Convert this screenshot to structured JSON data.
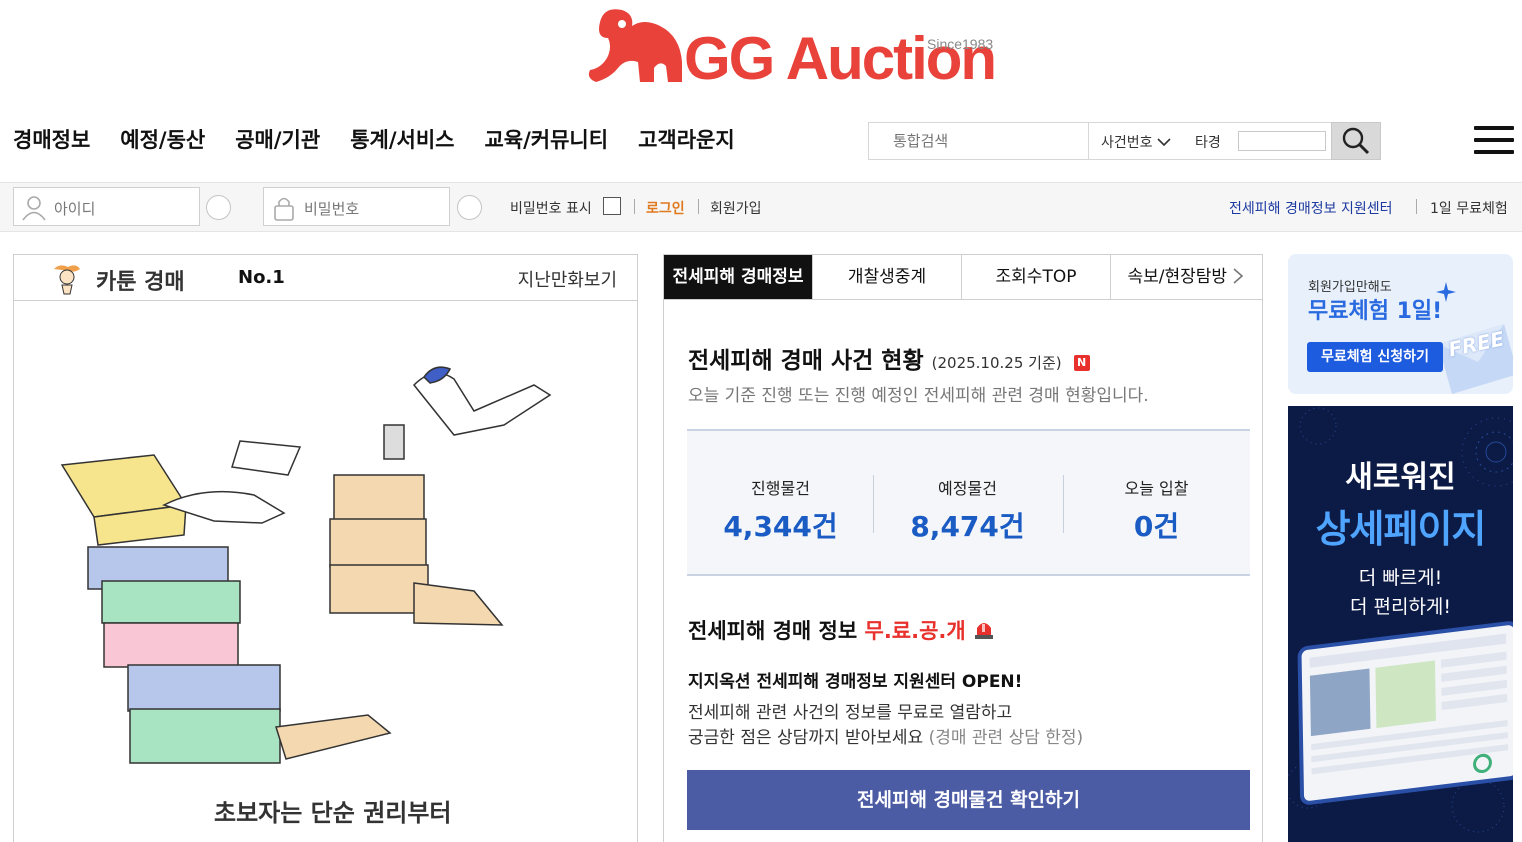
{
  "logo": {
    "brand": "GG Auction",
    "since": "Since1983"
  },
  "nav": {
    "items": [
      "경매정보",
      "예정/동산",
      "공매/기관",
      "통계/서비스",
      "교육/커뮤니티",
      "고객라운지"
    ]
  },
  "search": {
    "placeholder": "통합검색",
    "case_select": "사건번호",
    "court_label": "타경",
    "icon": "search-icon"
  },
  "login": {
    "id_placeholder": "아이디",
    "pw_placeholder": "비밀번호",
    "show_pw_label": "비밀번호 표시",
    "login_label": "로그인",
    "join_label": "회원가입",
    "center_link": "전세피해 경매정보 지원센터",
    "trial_link": "1일 무료체험"
  },
  "cartoon": {
    "title": "카툰 경매",
    "number": "No.1",
    "past_link": "지난만화보기",
    "caption": "초보자는 단순 권리부터"
  },
  "tabs": [
    "전세피해 경매정보",
    "개찰생중계",
    "조회수TOP",
    "속보/현장탐방"
  ],
  "status": {
    "title": "전세피해 경매 사건 현황",
    "date": "(2025.10.25 기준)",
    "new_badge": "N",
    "desc": "오늘 기준 진행 또는 진행 예정인 전세피해 관련 경매 현황입니다.",
    "stats": [
      {
        "label": "진행물건",
        "value": "4,344건"
      },
      {
        "label": "예정물건",
        "value": "8,474건"
      },
      {
        "label": "오늘 입찰",
        "value": "0건"
      }
    ]
  },
  "free": {
    "title": "전세피해 경매 정보",
    "title_red": "무.료.공.개",
    "subtitle": "지지옥션 전세피해 경매정보 지원센터 OPEN!",
    "desc_line1": "전세피해 관련 사건의 정보를 무료로 열람하고",
    "desc_line2": "궁금한 점은 상담까지 받아보세요",
    "desc_note": "(경매 관련 상담 한정)",
    "cta": "전세피해 경매물건 확인하기"
  },
  "banner1": {
    "small": "회원가입만해도",
    "big": "무료체험 1일!",
    "button": "무료체험 신청하기",
    "free": "FREE"
  },
  "banner2": {
    "line1": "새로워진",
    "line2": "상세페이지",
    "line3": "더 빠르게!",
    "line4": "더 편리하게!"
  },
  "colors": {
    "brand": "#e8423b",
    "accent_blue": "#1b5bc4",
    "cta": "#4b5ba4",
    "banner_dark": "#0c1a46"
  }
}
